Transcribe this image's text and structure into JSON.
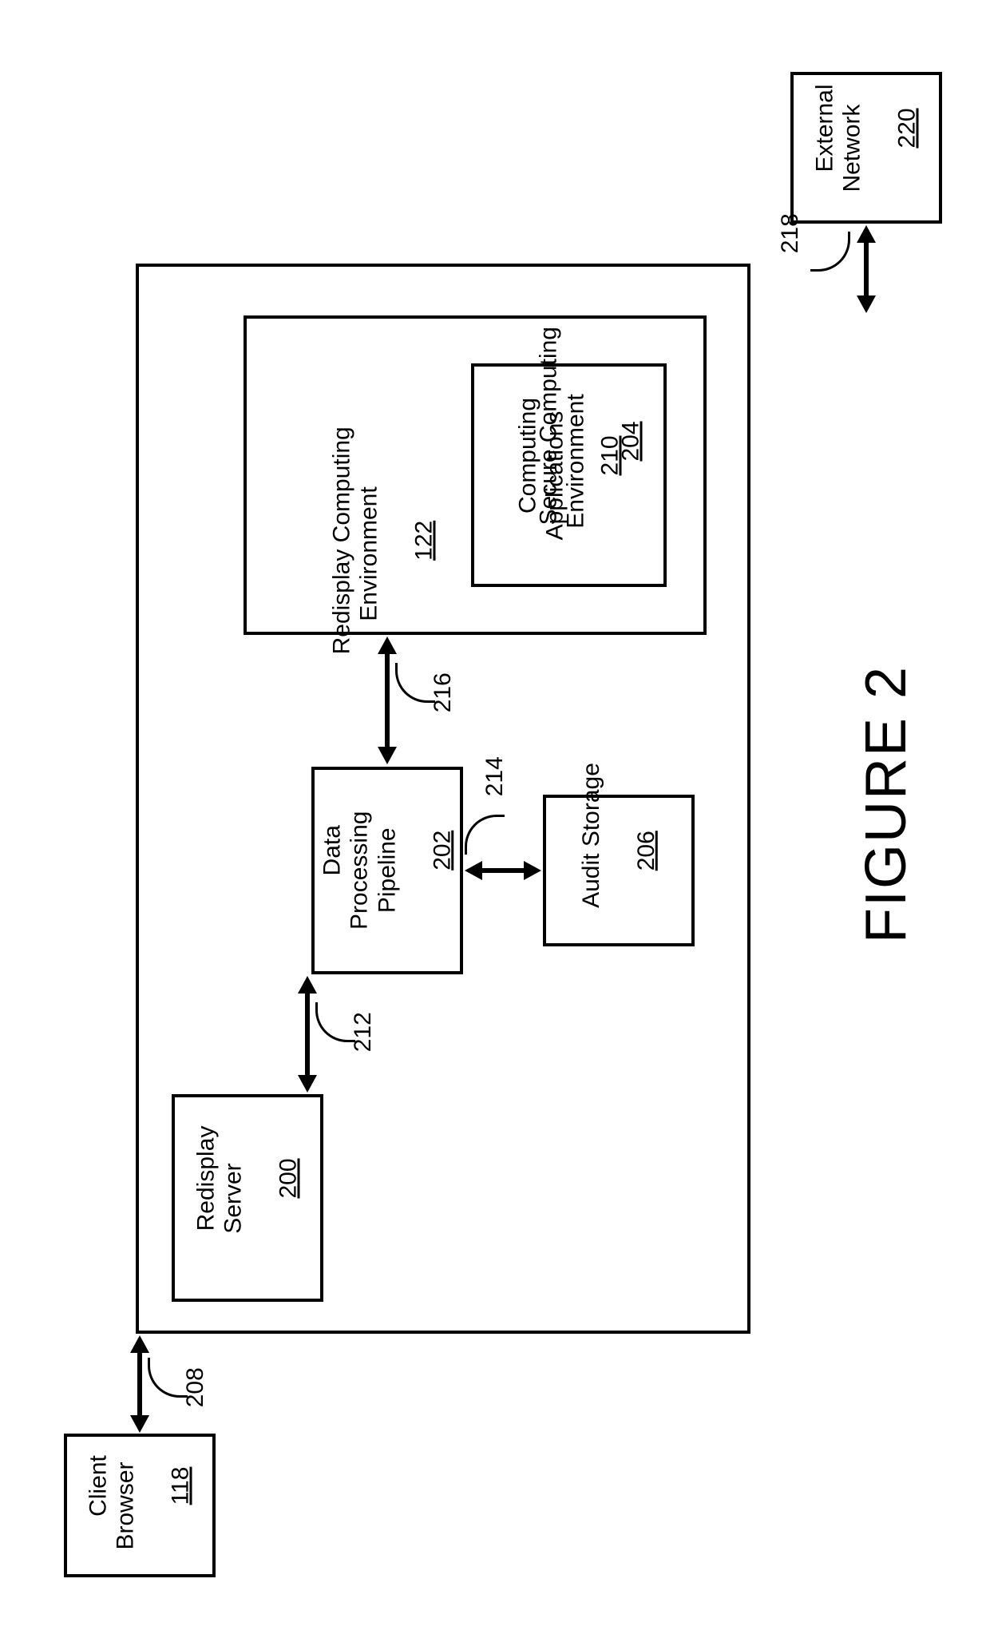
{
  "figure_caption": "FIGURE 2",
  "env": {
    "title": "Redisplay Computing\nEnvironment",
    "ref": "122"
  },
  "boxes": {
    "client_browser": {
      "title": "Client\nBrowser",
      "ref": "118"
    },
    "redisplay_server": {
      "title": "Redisplay\nServer",
      "ref": "200"
    },
    "data_pipeline": {
      "title": "Data\nProcessing\nPipeline",
      "ref": "202"
    },
    "audit_storage": {
      "title": "Audit Storage",
      "ref": "206"
    },
    "secure_env": {
      "title": "Secure Computing\nEnvironment",
      "ref": "204"
    },
    "computing_apps": {
      "title": "Computing\nApplications",
      "ref": "210"
    },
    "external_network": {
      "title": "External\nNetwork",
      "ref": "220"
    }
  },
  "connectors": {
    "c208": "208",
    "c212": "212",
    "c214": "214",
    "c216": "216",
    "c218": "218"
  }
}
